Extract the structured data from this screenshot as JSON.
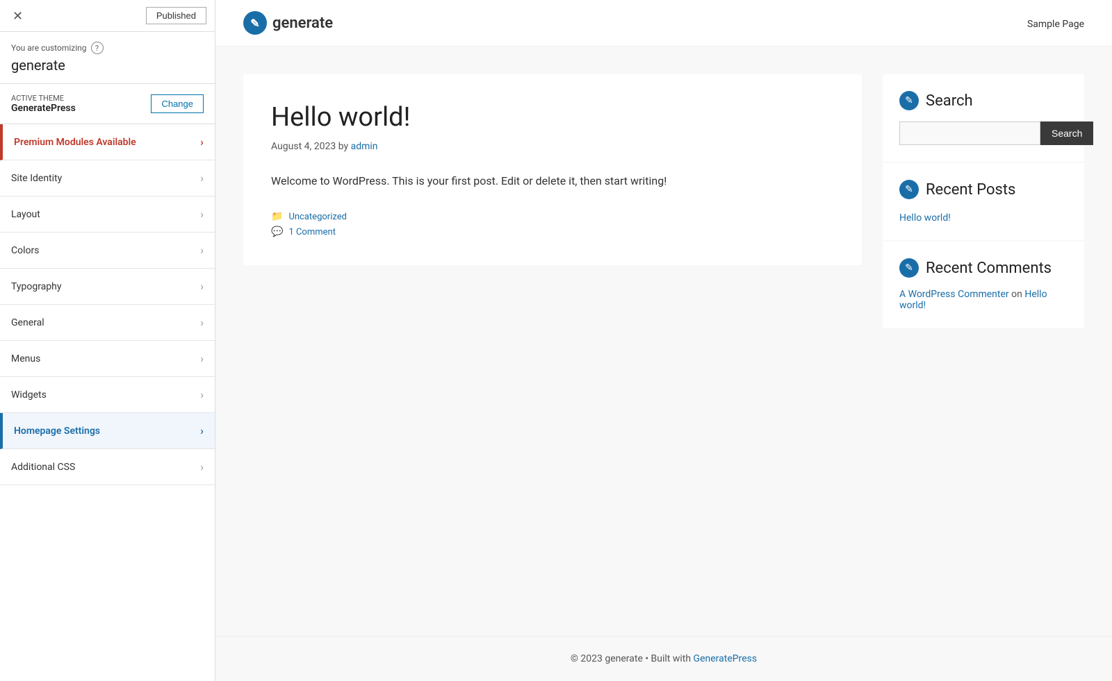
{
  "topbar": {
    "close_label": "✕",
    "published_label": "Published"
  },
  "info": {
    "you_are_customizing": "You are customizing",
    "help_icon": "?",
    "site_name": "generate"
  },
  "active_theme": {
    "label": "Active theme",
    "theme_name": "GeneratePress",
    "change_label": "Change"
  },
  "nav_items": [
    {
      "id": "premium",
      "label": "Premium Modules Available",
      "type": "premium"
    },
    {
      "id": "site-identity",
      "label": "Site Identity",
      "type": "normal"
    },
    {
      "id": "layout",
      "label": "Layout",
      "type": "normal"
    },
    {
      "id": "colors",
      "label": "Colors",
      "type": "normal"
    },
    {
      "id": "typography",
      "label": "Typography",
      "type": "normal"
    },
    {
      "id": "general",
      "label": "General",
      "type": "normal"
    },
    {
      "id": "menus",
      "label": "Menus",
      "type": "normal"
    },
    {
      "id": "widgets",
      "label": "Widgets",
      "type": "normal"
    },
    {
      "id": "homepage-settings",
      "label": "Homepage Settings",
      "type": "active"
    },
    {
      "id": "additional-css",
      "label": "Additional CSS",
      "type": "normal"
    }
  ],
  "site_header": {
    "logo_icon": "✎",
    "site_name": "generate",
    "nav_link": "Sample Page"
  },
  "post": {
    "title": "Hello world!",
    "date": "August 4, 2023",
    "by": "by",
    "author": "admin",
    "content": "Welcome to WordPress. This is your first post. Edit or delete it, then start writing!",
    "category": "Uncategorized",
    "comment": "1 Comment"
  },
  "sidebar": {
    "search_widget": {
      "title": "Search",
      "icon": "✎",
      "button_label": "Search",
      "input_placeholder": ""
    },
    "recent_posts_widget": {
      "title": "Recent Posts",
      "icon": "✎",
      "posts": [
        {
          "title": "Hello world!"
        }
      ]
    },
    "recent_comments_widget": {
      "title": "Recent Comments",
      "icon": "✎",
      "comments": [
        {
          "author": "A WordPress Commenter",
          "on": "on",
          "post": "Hello world!"
        }
      ]
    }
  },
  "footer": {
    "text": "© 2023 generate • Built with",
    "link_label": "GeneratePress"
  }
}
